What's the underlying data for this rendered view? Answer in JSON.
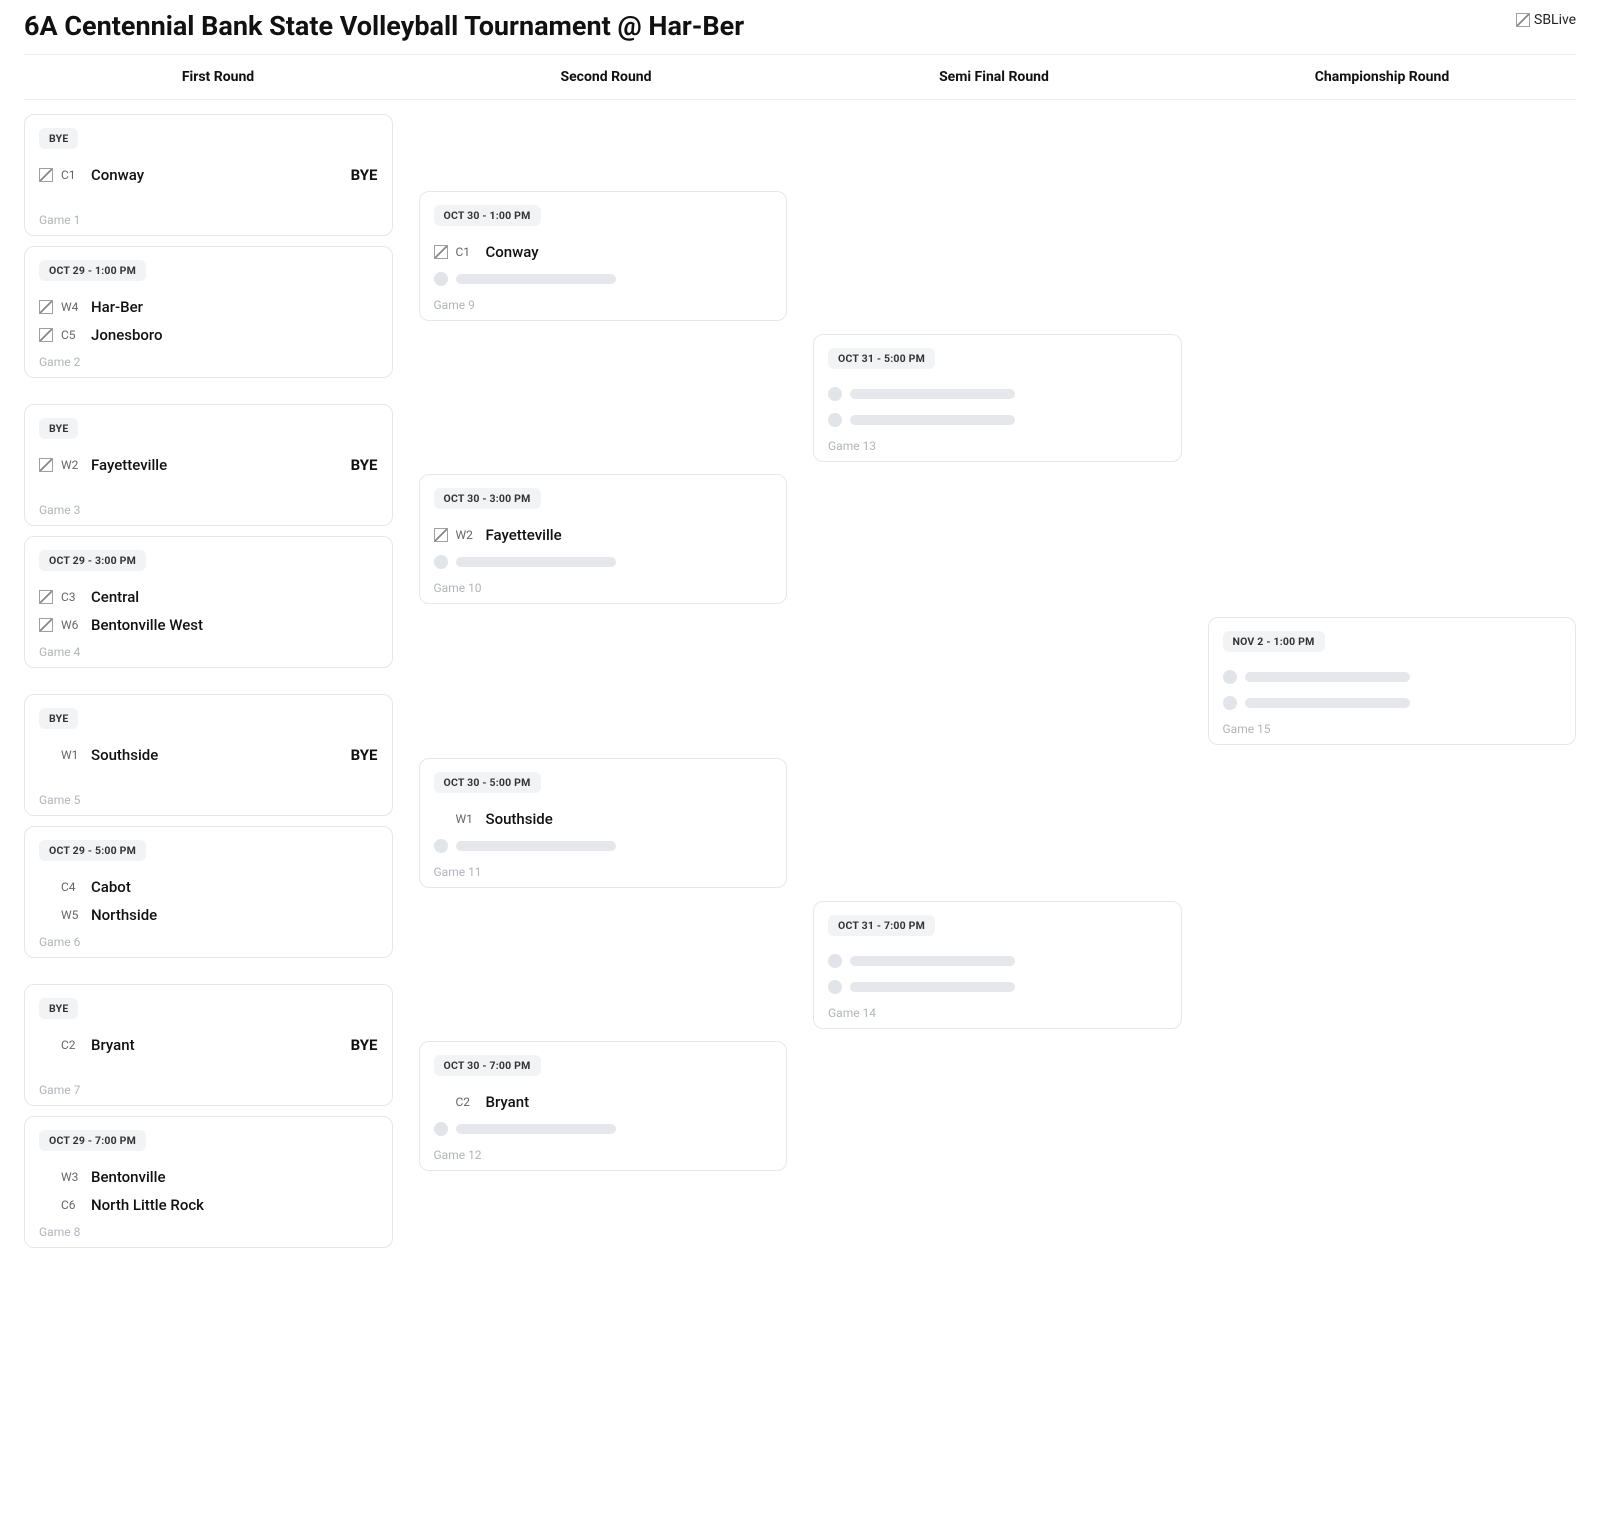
{
  "title": "6A Centennial Bank State Volleyball Tournament @ Har-Ber",
  "logo_alt": "SBLive",
  "rounds": [
    "First Round",
    "Second Round",
    "Semi Final Round",
    "Championship Round"
  ],
  "bye_label": "BYE",
  "r1": [
    {
      "badge": "BYE",
      "t1": {
        "seed": "C1",
        "name": "Conway",
        "img": true
      },
      "score": "BYE",
      "game": "Game 1"
    },
    {
      "badge": "OCT 29 - 1:00 PM",
      "t1": {
        "seed": "W4",
        "name": "Har-Ber",
        "img": true
      },
      "t2": {
        "seed": "C5",
        "name": "Jonesboro",
        "img": true
      },
      "game": "Game 2"
    },
    {
      "badge": "BYE",
      "t1": {
        "seed": "W2",
        "name": "Fayetteville",
        "img": true
      },
      "score": "BYE",
      "game": "Game 3"
    },
    {
      "badge": "OCT 29 - 3:00 PM",
      "t1": {
        "seed": "C3",
        "name": "Central",
        "img": true
      },
      "t2": {
        "seed": "W6",
        "name": "Bentonville West",
        "img": true
      },
      "game": "Game 4"
    },
    {
      "badge": "BYE",
      "t1": {
        "seed": "W1",
        "name": "Southside",
        "img": false
      },
      "score": "BYE",
      "game": "Game 5"
    },
    {
      "badge": "OCT 29 - 5:00 PM",
      "t1": {
        "seed": "C4",
        "name": "Cabot",
        "img": false
      },
      "t2": {
        "seed": "W5",
        "name": "Northside",
        "img": false
      },
      "game": "Game 6"
    },
    {
      "badge": "BYE",
      "t1": {
        "seed": "C2",
        "name": "Bryant",
        "img": false
      },
      "score": "BYE",
      "game": "Game 7"
    },
    {
      "badge": "OCT 29 - 7:00 PM",
      "t1": {
        "seed": "W3",
        "name": "Bentonville",
        "img": false
      },
      "t2": {
        "seed": "C6",
        "name": "North Little Rock",
        "img": false
      },
      "game": "Game 8"
    }
  ],
  "r2": [
    {
      "badge": "OCT 30 - 1:00 PM",
      "t1": {
        "seed": "C1",
        "name": "Conway",
        "img": true
      },
      "tbd": true,
      "game": "Game 9"
    },
    {
      "badge": "OCT 30 - 3:00 PM",
      "t1": {
        "seed": "W2",
        "name": "Fayetteville",
        "img": true
      },
      "tbd": true,
      "game": "Game 10"
    },
    {
      "badge": "OCT 30 - 5:00 PM",
      "t1": {
        "seed": "W1",
        "name": "Southside",
        "img": false
      },
      "tbd": true,
      "game": "Game 11"
    },
    {
      "badge": "OCT 30 - 7:00 PM",
      "t1": {
        "seed": "C2",
        "name": "Bryant",
        "img": false
      },
      "tbd": true,
      "game": "Game 12"
    }
  ],
  "sf": [
    {
      "badge": "OCT 31 - 5:00 PM",
      "tbd2": true,
      "game": "Game 13"
    },
    {
      "badge": "OCT 31 - 7:00 PM",
      "tbd2": true,
      "game": "Game 14"
    }
  ],
  "final": {
    "badge": "NOV 2 - 1:00 PM",
    "tbd2": true,
    "game": "Game 15"
  }
}
